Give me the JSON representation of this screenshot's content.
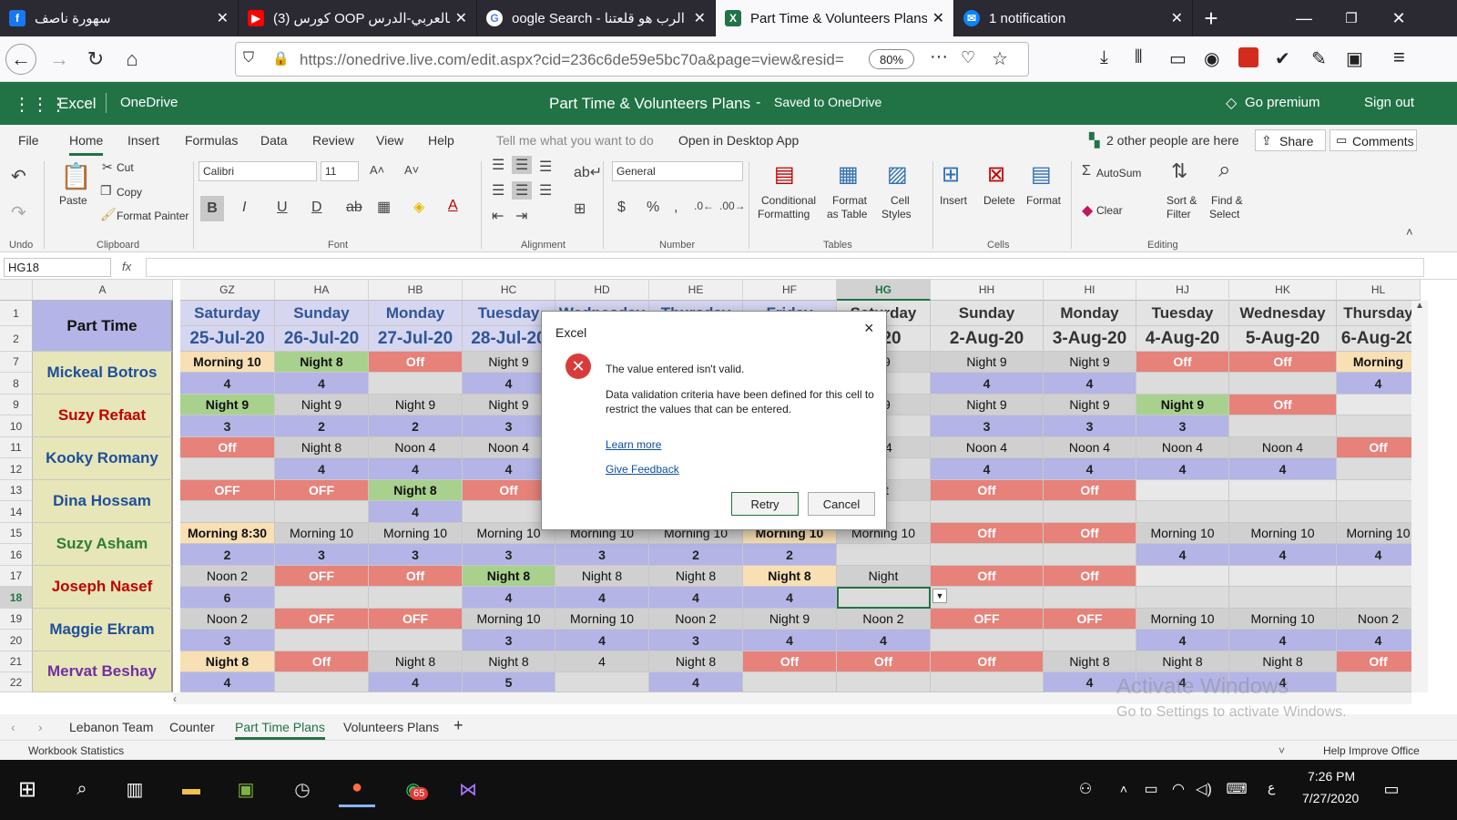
{
  "colors": {
    "excel_green": "#217346",
    "tab_dark": "#2b2a33",
    "green_cell": "#a9d18e",
    "red_cell": "#e6827a",
    "peach_cell": "#f8dfb4",
    "gray_cell": "#d0d0d0",
    "purple_cell": "#b4b4e6",
    "name_bg": "#e6e6b8"
  },
  "browser": {
    "tabs": [
      {
        "label": "سهورة ناصف",
        "icon": "facebook-icon"
      },
      {
        "label": "(3) كورس OOP بالعربي-الدرس",
        "icon": "youtube-icon"
      },
      {
        "label": "oogle Search - الرب هو قلعتنا",
        "icon": "google-icon"
      },
      {
        "label": "Part Time & Volunteers Plans",
        "icon": "excel-icon"
      },
      {
        "label": "1 notification",
        "icon": "mail-icon"
      }
    ],
    "url": "https://onedrive.live.com/edit.aspx?cid=236c6de59e5bc70a&page=view&resid=",
    "zoom": "80%"
  },
  "excel": {
    "app": "Excel",
    "service": "OneDrive",
    "doc_title": "Part Time & Volunteers Plans",
    "separator": "-",
    "saved": "Saved to OneDrive",
    "premium": "Go premium",
    "signout": "Sign out",
    "menu": [
      "File",
      "Home",
      "Insert",
      "Formulas",
      "Data",
      "Review",
      "View",
      "Help"
    ],
    "tell_me": "Tell me what you want to do",
    "open_desktop": "Open in Desktop App",
    "people": "2 other people are here",
    "share": "Share",
    "comments": "Comments",
    "ribbon": {
      "undo": "Undo",
      "paste": "Paste",
      "cut": "Cut",
      "copy": "Copy",
      "format_painter": "Format Painter",
      "clipboard": "Clipboard",
      "font_name": "Calibri",
      "font_size": "11",
      "font": "Font",
      "alignment": "Alignment",
      "number_format": "General",
      "number": "Number",
      "cond_format_1": "Conditional",
      "cond_format_2": "Formatting",
      "format_table_1": "Format",
      "format_table_2": "as Table",
      "cell_styles_1": "Cell",
      "cell_styles_2": "Styles",
      "tables": "Tables",
      "insert": "Insert",
      "delete": "Delete",
      "format": "Format",
      "cells": "Cells",
      "autosum": "AutoSum",
      "clear": "Clear",
      "sort_1": "Sort &",
      "sort_2": "Filter",
      "find_1": "Find &",
      "find_2": "Select",
      "editing": "Editing"
    },
    "name_box": "HG18",
    "fx": "fx",
    "col_a": "A",
    "columns": [
      "GZ",
      "HA",
      "HB",
      "HC",
      "HD",
      "HE",
      "HF",
      "HG",
      "HH",
      "HI",
      "HJ",
      "HK",
      "HL"
    ],
    "days": [
      "Saturday",
      "Sunday",
      "Monday",
      "Tuesday",
      "Wednesday",
      "Thursday",
      "Friday",
      "Saturday",
      "Sunday",
      "Monday",
      "Tuesday",
      "Wednesday",
      "Thursday"
    ],
    "dates": [
      "25-Jul-20",
      "26-Jul-20",
      "27-Jul-20",
      "28-Jul-20",
      "",
      "",
      "",
      "g-20",
      "2-Aug-20",
      "3-Aug-20",
      "4-Aug-20",
      "5-Aug-20",
      "6-Aug-20"
    ],
    "header_label": "Part Time",
    "row_numbers": [
      "1",
      "2",
      "7",
      "8",
      "9",
      "10",
      "11",
      "12",
      "13",
      "14",
      "15",
      "16",
      "17",
      "18",
      "19",
      "20",
      "21",
      "22"
    ],
    "people_list": [
      {
        "name": "Mickeal Botros",
        "shift": [
          [
            "Morning 10",
            "p"
          ],
          [
            "Night 8",
            "g"
          ],
          [
            "Off",
            "r"
          ],
          [
            "Night 9",
            ""
          ],
          [
            "",
            ""
          ],
          [
            "",
            ""
          ],
          [
            "",
            ""
          ],
          [
            "t 9",
            ""
          ],
          [
            "Night 9",
            ""
          ],
          [
            "Night 9",
            ""
          ],
          [
            "Off",
            "r"
          ],
          [
            "Off",
            "r"
          ],
          [
            "Morning",
            "p"
          ]
        ],
        "hours": [
          "4",
          "4",
          "",
          "4",
          "",
          "",
          "",
          "",
          "4",
          "4",
          "",
          "",
          "4"
        ]
      },
      {
        "name": "Suzy Refaat",
        "shift": [
          [
            "Night 9",
            "g"
          ],
          [
            "Night 9",
            ""
          ],
          [
            "Night 9",
            ""
          ],
          [
            "Night 9",
            ""
          ],
          [
            "",
            ""
          ],
          [
            "",
            ""
          ],
          [
            "",
            ""
          ],
          [
            "t 9",
            ""
          ],
          [
            "Night 9",
            ""
          ],
          [
            "Night 9",
            ""
          ],
          [
            "Night 9",
            "g"
          ],
          [
            "Off",
            "r"
          ],
          [
            "",
            ""
          ]
        ],
        "hours": [
          "3",
          "2",
          "2",
          "3",
          "",
          "",
          "",
          "",
          "3",
          "3",
          "3",
          "",
          ""
        ]
      },
      {
        "name": "Kooky Romany",
        "shift": [
          [
            "Off",
            "r"
          ],
          [
            "Night 8",
            ""
          ],
          [
            "Noon 4",
            ""
          ],
          [
            "Noon 4",
            ""
          ],
          [
            "",
            ""
          ],
          [
            "",
            ""
          ],
          [
            "",
            ""
          ],
          [
            "n 4",
            ""
          ],
          [
            "Noon 4",
            ""
          ],
          [
            "Noon 4",
            ""
          ],
          [
            "Noon 4",
            ""
          ],
          [
            "Noon 4",
            ""
          ],
          [
            "Off",
            "r"
          ]
        ],
        "hours": [
          "",
          "4",
          "4",
          "4",
          "",
          "",
          "",
          "",
          "4",
          "4",
          "4",
          "4",
          ""
        ]
      },
      {
        "name": "Dina Hossam",
        "shift": [
          [
            "OFF",
            "r"
          ],
          [
            "OFF",
            "r"
          ],
          [
            "Night 8",
            "g"
          ],
          [
            "Off",
            "r"
          ],
          [
            "",
            ""
          ],
          [
            "",
            ""
          ],
          [
            "",
            ""
          ],
          [
            "ht",
            ""
          ],
          [
            "Off",
            "r"
          ],
          [
            "Off",
            "r"
          ],
          [
            "",
            ""
          ],
          [
            "",
            ""
          ],
          [
            "",
            ""
          ]
        ],
        "hours": [
          "",
          "",
          "4",
          "",
          "",
          "",
          "",
          "",
          "",
          "",
          "",
          "",
          ""
        ]
      },
      {
        "name": "Suzy Asham",
        "shift": [
          [
            "Morning 8:30",
            "p"
          ],
          [
            "Morning 10",
            ""
          ],
          [
            "Morning 10",
            ""
          ],
          [
            "Morning 10",
            ""
          ],
          [
            "Morning 10",
            ""
          ],
          [
            "Morning 10",
            ""
          ],
          [
            "Morning 10",
            "p"
          ],
          [
            "Morning 10",
            ""
          ],
          [
            "Off",
            "r"
          ],
          [
            "Off",
            "r"
          ],
          [
            "Morning 10",
            ""
          ],
          [
            "Morning 10",
            ""
          ],
          [
            "Morning 10",
            ""
          ]
        ],
        "hours": [
          "2",
          "3",
          "3",
          "3",
          "3",
          "2",
          "2",
          "",
          "",
          "",
          "4",
          "4",
          "4"
        ]
      },
      {
        "name": "Joseph Nasef",
        "shift": [
          [
            "Noon 2",
            ""
          ],
          [
            "OFF",
            "r"
          ],
          [
            "Off",
            "r"
          ],
          [
            "Night 8",
            "g"
          ],
          [
            "Night 8",
            ""
          ],
          [
            "Night 8",
            ""
          ],
          [
            "Night 8",
            "p"
          ],
          [
            "Night",
            ""
          ],
          [
            "Off",
            "r"
          ],
          [
            "Off",
            "r"
          ],
          [
            "",
            ""
          ],
          [
            "",
            ""
          ],
          [
            "",
            ""
          ]
        ],
        "hours": [
          "6",
          "",
          "",
          "4",
          "4",
          "4",
          "4",
          "",
          "",
          "",
          "",
          "",
          ""
        ]
      },
      {
        "name": "Maggie Ekram",
        "shift": [
          [
            "Noon 2",
            ""
          ],
          [
            "OFF",
            "r"
          ],
          [
            "OFF",
            "r"
          ],
          [
            "Morning 10",
            ""
          ],
          [
            "Morning 10",
            ""
          ],
          [
            "Noon 2",
            ""
          ],
          [
            "Night 9",
            ""
          ],
          [
            "Noon 2",
            ""
          ],
          [
            "OFF",
            "r"
          ],
          [
            "OFF",
            "r"
          ],
          [
            "Morning 10",
            ""
          ],
          [
            "Morning 10",
            ""
          ],
          [
            "Noon 2",
            ""
          ]
        ],
        "hours": [
          "3",
          "",
          "",
          "3",
          "4",
          "3",
          "4",
          "4",
          "",
          "",
          "4",
          "4",
          "4"
        ]
      },
      {
        "name": "Mervat Beshay",
        "shift": [
          [
            "Night 8",
            "p"
          ],
          [
            "Off",
            "r"
          ],
          [
            "Night 8",
            ""
          ],
          [
            "Night 8",
            ""
          ],
          [
            "4",
            ""
          ],
          [
            "Night 8",
            ""
          ],
          [
            "Off",
            "r"
          ],
          [
            "Off",
            "r"
          ],
          [
            "Off",
            "r"
          ],
          [
            "Night 8",
            ""
          ],
          [
            "Night 8",
            ""
          ],
          [
            "Night 8",
            ""
          ],
          [
            "Off",
            "r"
          ]
        ],
        "hours": [
          "4",
          "",
          "4",
          "5",
          "",
          "4",
          "",
          "",
          "",
          "4",
          "4",
          "4",
          ""
        ]
      }
    ],
    "name_colors": [
      "#1f4e9c",
      "#c00000",
      "#1f4e9c",
      "#1f4e9c",
      "#2e7d32",
      "#c00000",
      "#1f4e9c",
      "#7030a0"
    ],
    "sheets": [
      "Lebanon Team",
      "Counter",
      "Part Time Plans",
      "Volunteers Plans",
      "+"
    ],
    "status_left": "Workbook Statistics",
    "status_right": "Help Improve Office",
    "watermark_1": "Activate Windows",
    "watermark_2": "Go to Settings to activate Windows."
  },
  "dialog": {
    "title": "Excel",
    "close": "×",
    "message": "The value entered isn't valid.",
    "detail": "Data validation criteria have been defined for this cell to restrict the values that can be entered.",
    "learn_more": "Learn more",
    "feedback": "Give Feedback",
    "retry": "Retry",
    "cancel": "Cancel"
  },
  "taskbar": {
    "time": "7:26 PM",
    "date": "7/27/2020",
    "badge": "65",
    "lang": "ع"
  }
}
